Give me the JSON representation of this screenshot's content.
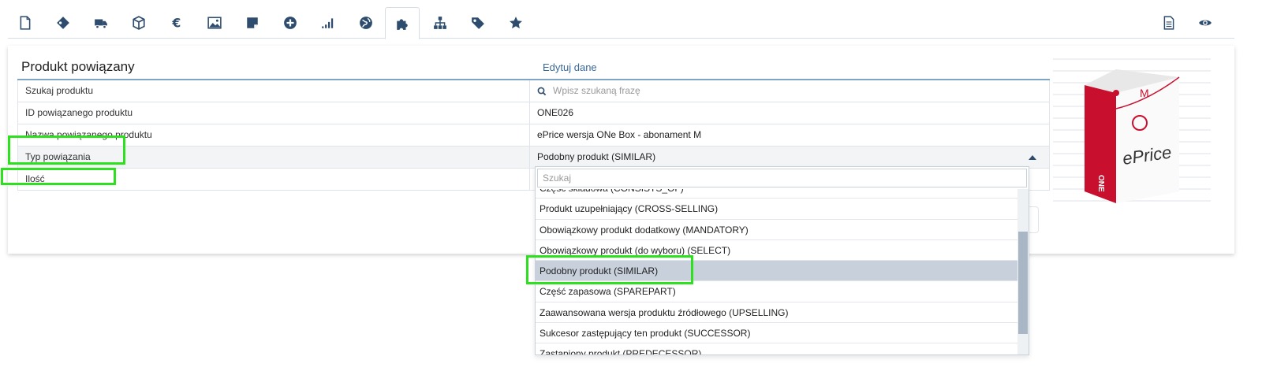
{
  "toolbar": {
    "tabs": [
      {
        "icon": "document-icon"
      },
      {
        "icon": "tag-diamond-icon"
      },
      {
        "icon": "truck-icon"
      },
      {
        "icon": "box-icon"
      },
      {
        "icon": "euro-icon"
      },
      {
        "icon": "image-icon"
      },
      {
        "icon": "note-icon"
      },
      {
        "icon": "plus-circle-icon"
      },
      {
        "icon": "signal-icon"
      },
      {
        "icon": "globe-icon"
      },
      {
        "icon": "puzzle-icon"
      },
      {
        "icon": "sitemap-icon"
      },
      {
        "icon": "label-icon"
      },
      {
        "icon": "star-icon"
      }
    ],
    "active_tab": "puzzle-icon",
    "right_icons": [
      "report-icon",
      "eye-icon"
    ],
    "accent_color": "#2e4d6e"
  },
  "section": {
    "title": "Produkt powiązany",
    "edit_label": "Edytuj dane"
  },
  "form": {
    "rows": [
      {
        "label": "Szukaj produktu",
        "value": "",
        "placeholder": "Wpisz szukaną frazę"
      },
      {
        "label": "ID powiązanego produktu",
        "value": "ONE026"
      },
      {
        "label": "Nazwa powiązanego produktu",
        "value": "ePrice wersja ONe Box - abonament M"
      },
      {
        "label": "Typ powiązania",
        "value": "Podobny produkt (SIMILAR)"
      },
      {
        "label": "Ilość",
        "value": ""
      }
    ]
  },
  "dropdown": {
    "search_placeholder": "Szukaj",
    "options": [
      "Część składowa (CONSISTS_OF)",
      "Produkt uzupełniający (CROSS-SELLING)",
      "Obowiązkowy produkt dodatkowy (MANDATORY)",
      "Obowiązkowy produkt (do wyboru) (SELECT)",
      "Podobny produkt (SIMILAR)",
      "Część zapasowa (SPAREPART)",
      "Zaawansowana wersja produktu źródłowego (UPSELLING)",
      "Sukcesor zastępujący ten produkt (SUCCESSOR)",
      "Zastąpiony produkt (PREDECESSOR)"
    ],
    "selected": "Podobny produkt (SIMILAR)"
  },
  "product_image": {
    "brand_text": "ePrice",
    "variant_letter": "M",
    "side_text": "ONE",
    "brand_color": "#c8102e"
  },
  "highlight_color": "#2ee11f"
}
